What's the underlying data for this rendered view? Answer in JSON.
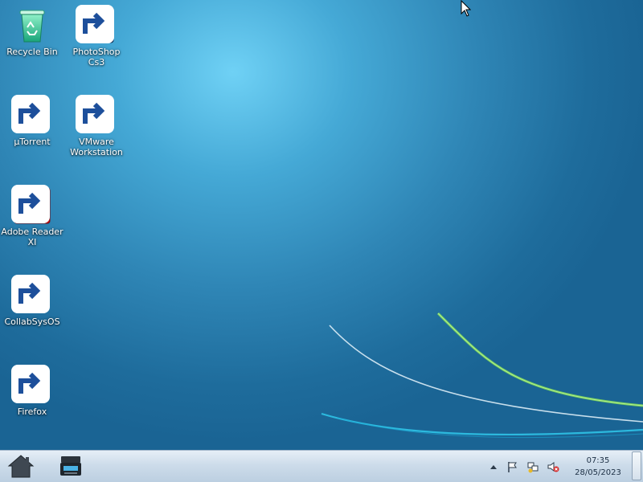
{
  "desktop": {
    "icons": [
      {
        "label": "Recycle Bin",
        "icon": "recycle-bin-icon"
      },
      {
        "label": "PhotoShop\nCs3",
        "icon": "photoshop-icon"
      },
      {
        "label": "µTorrent",
        "icon": "utorrent-icon"
      },
      {
        "label": "VMware\nWorkstation",
        "icon": "vmware-icon"
      },
      {
        "label": "Adobe Reader\nXI",
        "icon": "adobe-reader-icon"
      },
      {
        "label": "CollabSysOS",
        "icon": "folder-icon"
      },
      {
        "label": "Firefox",
        "icon": "firefox-icon"
      }
    ]
  },
  "taskbar": {
    "start_icon": "home-icon",
    "pinned_app_icon": "scanner-icon",
    "tray": [
      "chevron-up-icon",
      "flag-icon",
      "network-icon",
      "volume-muted-icon"
    ],
    "clock": {
      "time": "07:35",
      "date": "28/05/2023"
    }
  },
  "colors": {
    "wallpaper": "#2f86b6",
    "taskbar": "#cddcea",
    "swoosh_green": "#7ed957",
    "swoosh_white": "#e8f4fb",
    "swoosh_cyan": "#2fc2e6"
  }
}
